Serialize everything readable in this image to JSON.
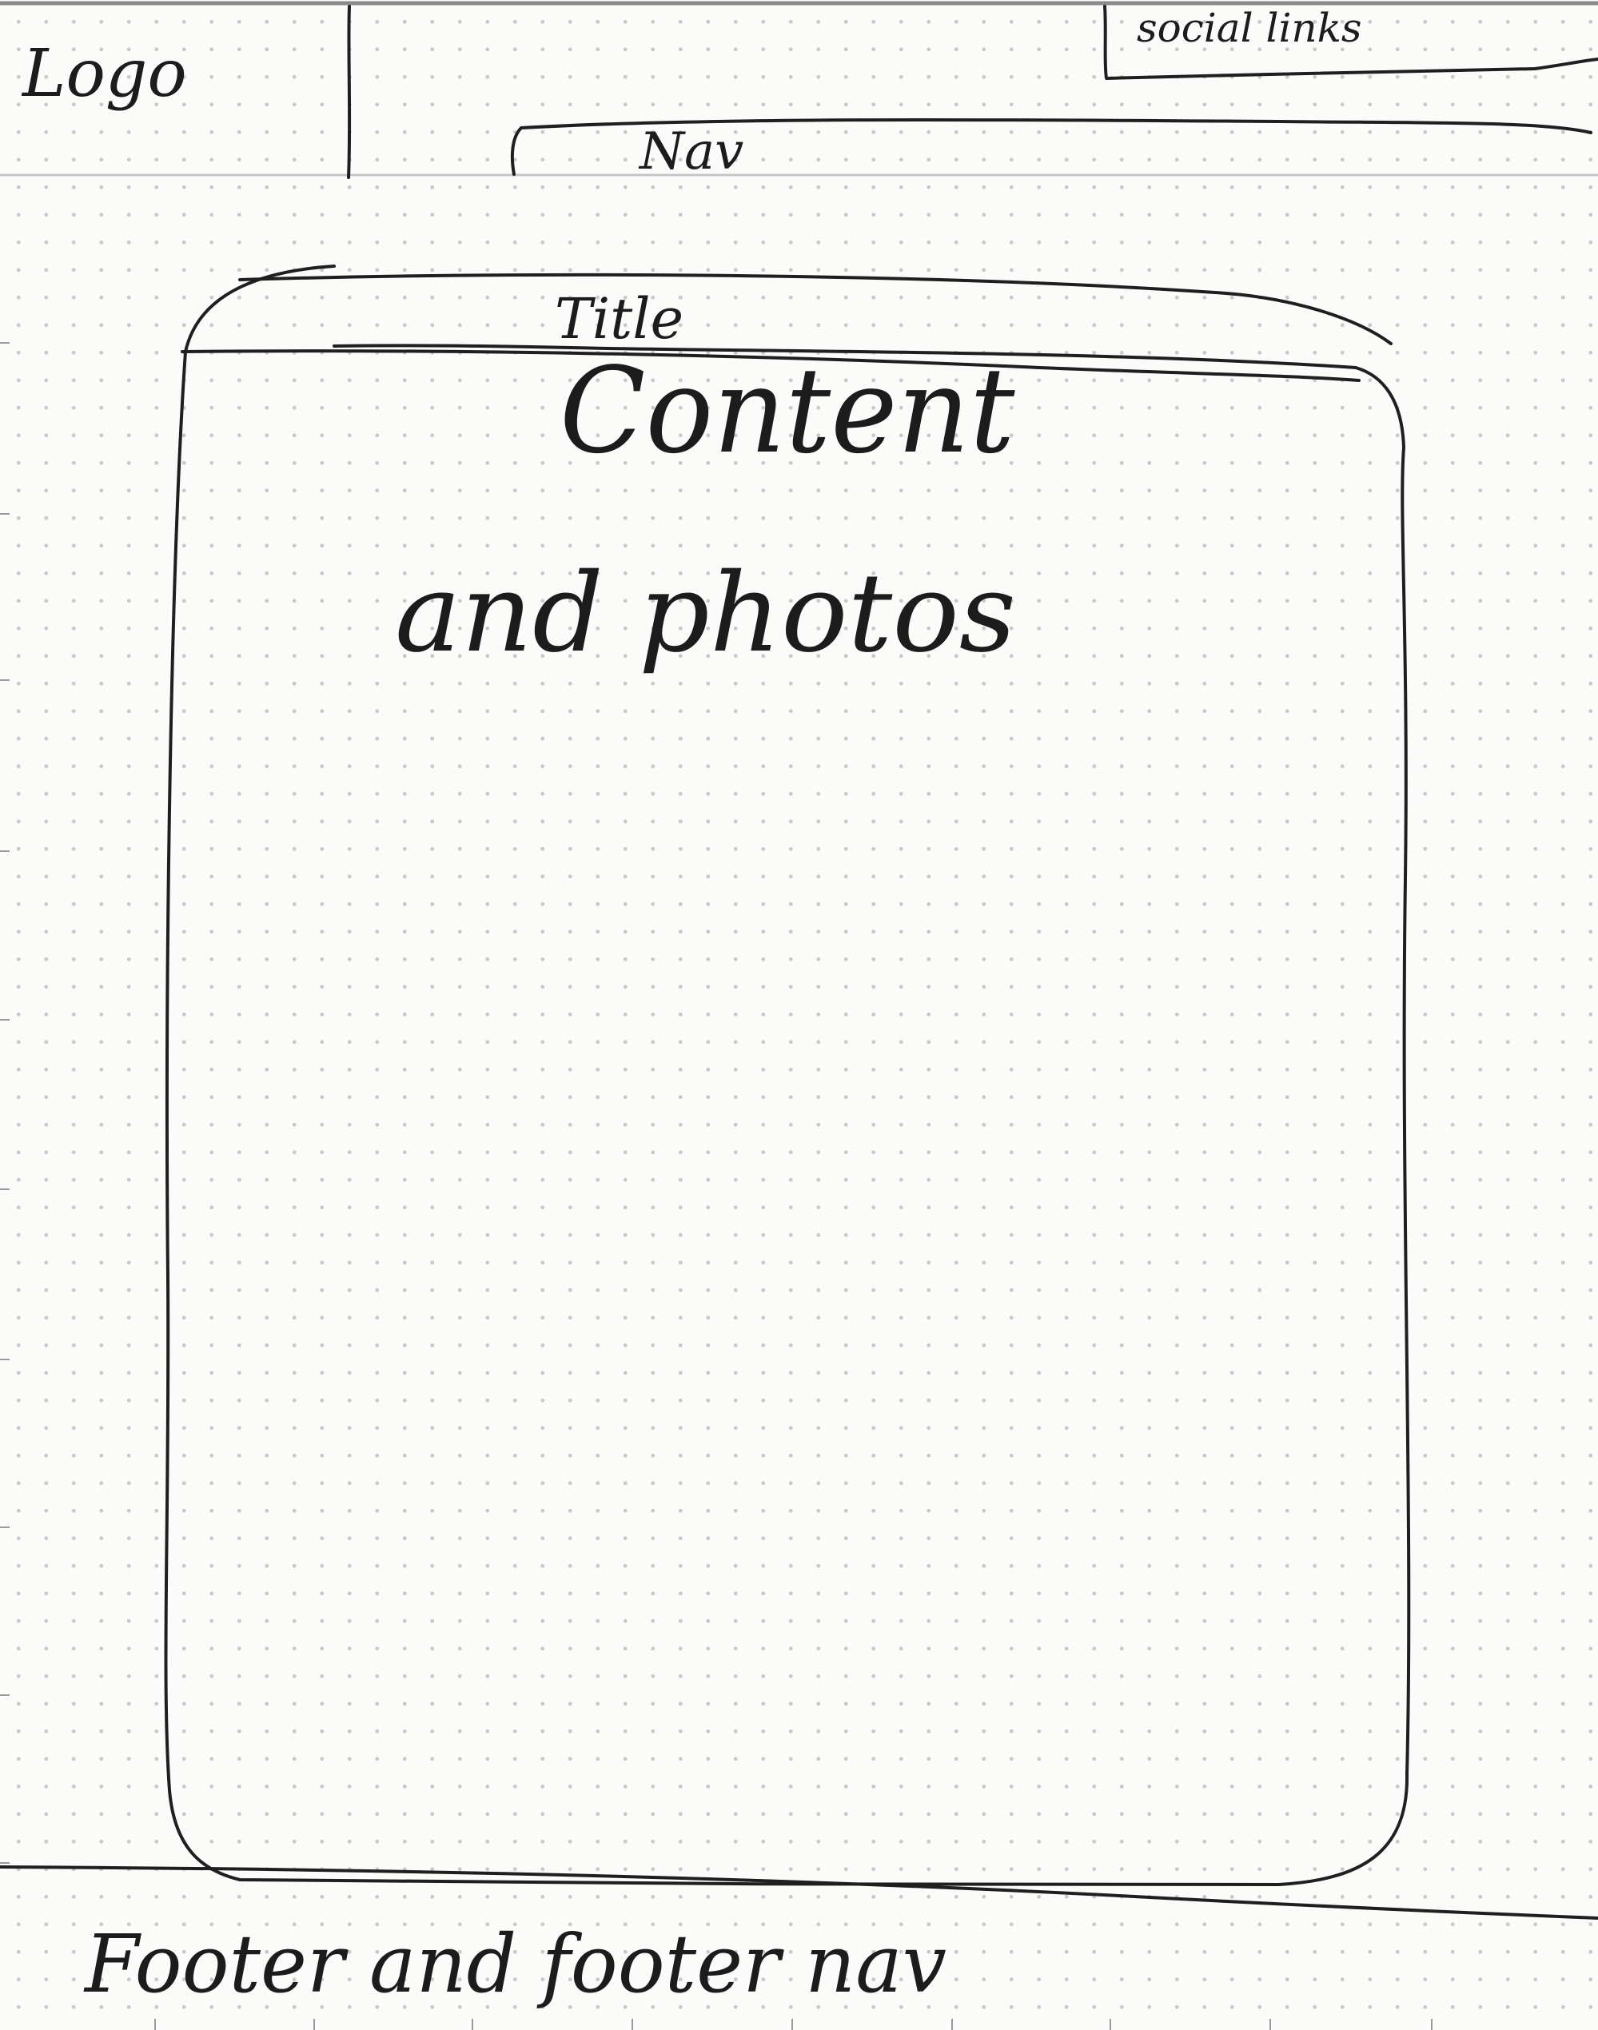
{
  "header": {
    "logo_label": "Logo",
    "social_links_label": "social links",
    "nav_label": "Nav"
  },
  "main": {
    "title_label": "Title",
    "content_line_1": "Content",
    "content_line_2": "and photos"
  },
  "footer": {
    "label": "Footer and footer nav"
  },
  "colors": {
    "ink": "#1f1f1f",
    "paper": "#fbfbf9",
    "grid_dot": "#c9c9c9"
  }
}
